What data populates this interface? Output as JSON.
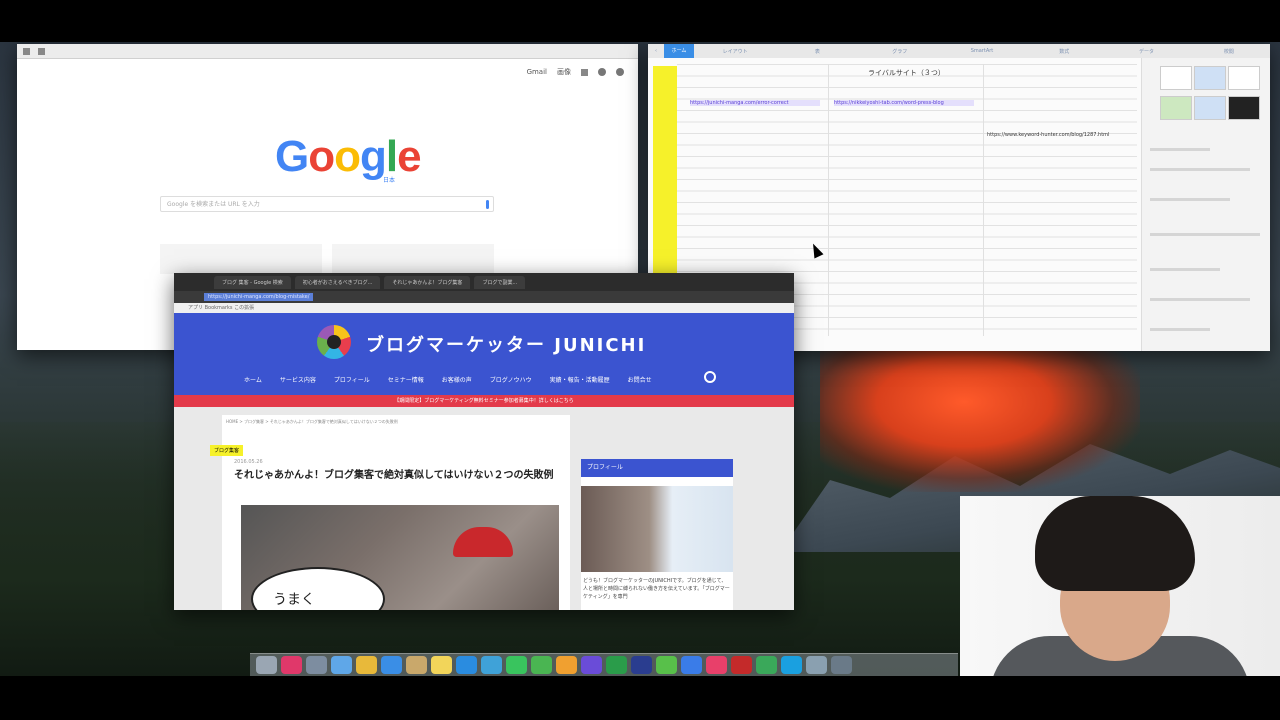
{
  "google": {
    "gmail_label": "Gmail",
    "images_label": "画像",
    "logo_letters": [
      "G",
      "o",
      "o",
      "g",
      "l",
      "e"
    ],
    "logo_sub": "日本",
    "search_placeholder": "Google を検索または URL を入力"
  },
  "spreadsheet": {
    "tabs": [
      "ホーム",
      "レイアウト",
      "表",
      "グラフ",
      "SmartArt",
      "数式",
      "データ",
      "校閲"
    ],
    "active_tab": "ホーム",
    "title": "ライバルサイト（３つ）",
    "cells": [
      "https://junichi-manga.com/error-correct",
      "https://nikkeiyoshi-tab.com/word-press-blog",
      "https://www.keyword-hunter.com/blog/1287.html"
    ]
  },
  "blog": {
    "tabs": [
      "ブログ 集客 - Google 検索",
      "初心者がおさえるべきブログ...",
      "それじゃあかんよ！ブログ集客",
      "ブログで副業..."
    ],
    "url": "https://junichi-manga.com/blog-mistake/",
    "bookmarks": "アプリ  Bookmarks  この拡張",
    "site_title": "ブログマーケッター JUNICHI",
    "nav": [
      "ホーム",
      "サービス内容",
      "プロフィール",
      "セミナー情報",
      "お客様の声",
      "ブログノウハウ",
      "実績・報告・活動履歴",
      "お問合せ"
    ],
    "alert": "【期間限定】ブログマーケティング無料セミナー参加者募集中！詳しくはこちら",
    "breadcrumb": "HOME > ブログ集客 > それじゃあかんよ！ブログ集客で絶対真似してはいけない２つの失敗例",
    "category": "ブログ集客",
    "date": "2016.05.26",
    "headline": "それじゃあかんよ！ブログ集客で絶対真似してはいけない２つの失敗例",
    "hero_text": "うまく",
    "sidebar_heading": "プロフィール",
    "sidebar_text": "どうも！ブログマーケッターのJUNICHIです。ブログを通じて、人と場所と時間に縛られない働き方を伝えています。「ブログマーケティング」を専門"
  },
  "colors": {
    "blog_blue": "#3b54d0",
    "alert_red": "#e33a4a",
    "highlight_yellow": "#f6f12a",
    "active_tab_blue": "#3a8ee6"
  },
  "dock": {
    "icons": [
      "finder-icon",
      "itunes-icon",
      "launchpad-icon",
      "mail-icon",
      "chrome-icon",
      "safari-icon",
      "contacts-icon",
      "notes-icon",
      "app-store-icon",
      "preview-icon",
      "messages-icon",
      "evernote-icon",
      "photos-icon",
      "imovie-icon",
      "camtasia-icon",
      "photoshop-icon",
      "line-icon",
      "dropbox-icon",
      "music-icon",
      "filezilla-icon",
      "facetime-icon",
      "skype-icon",
      "chart-icon",
      "help-icon"
    ]
  }
}
